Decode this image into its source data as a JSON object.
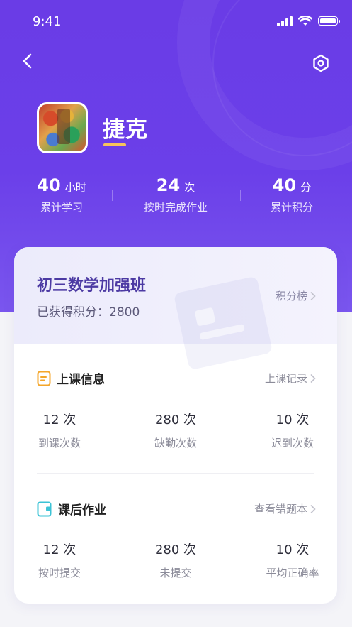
{
  "status_bar": {
    "time": "9:41"
  },
  "icons": {
    "back": "chevron-left-icon",
    "settings": "hexagon-settings-icon",
    "signal": "signal-icon",
    "wifi": "wifi-icon",
    "battery": "battery-icon"
  },
  "colors": {
    "header": "#6a3ce6",
    "accent": "#f7c35b",
    "class_title": "#4c3aa3"
  },
  "profile": {
    "name": "捷克"
  },
  "stats": [
    {
      "value": "40",
      "unit": "小时",
      "label": "累计学习"
    },
    {
      "value": "24",
      "unit": "次",
      "label": "按时完成作业"
    },
    {
      "value": "40",
      "unit": "分",
      "label": "累计积分"
    }
  ],
  "class_card": {
    "name": "初三数学加强班",
    "points_text": "已获得积分：2800",
    "rank_link": "积分榜"
  },
  "class_info": {
    "title": "上课信息",
    "link": "上课记录",
    "metrics": [
      {
        "value": "12 次",
        "label": "到课次数"
      },
      {
        "value": "280 次",
        "label": "缺勤次数"
      },
      {
        "value": "10 次",
        "label": "迟到次数"
      }
    ]
  },
  "homework": {
    "title": "课后作业",
    "link": "查看错题本",
    "metrics": [
      {
        "value": "12 次",
        "label": "按时提交"
      },
      {
        "value": "280 次",
        "label": "未提交"
      },
      {
        "value": "10 次",
        "label": "平均正确率"
      }
    ]
  }
}
